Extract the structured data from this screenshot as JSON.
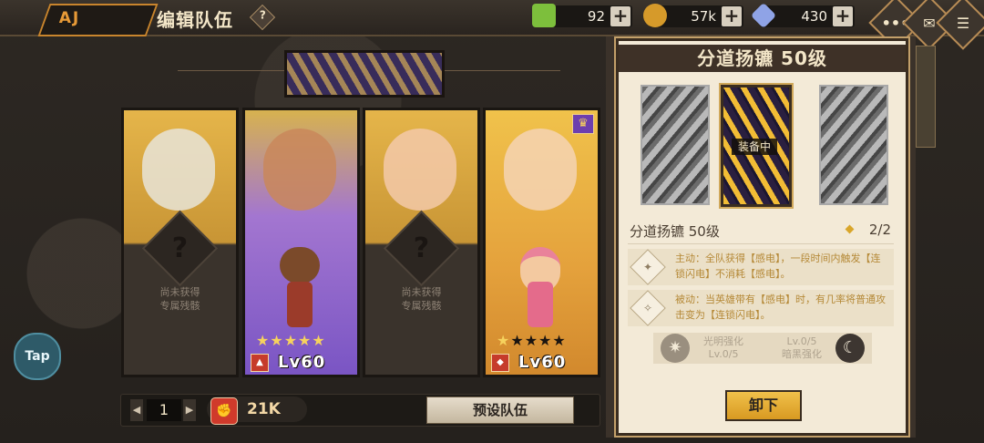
{
  "header": {
    "title": "编辑队伍",
    "help": "?",
    "logo_text": "AJ"
  },
  "resources": [
    {
      "name": "green-gem",
      "value": "92",
      "plus": "+",
      "color": "#7dbf3c"
    },
    {
      "name": "gold-coin",
      "value": "57k",
      "plus": "+",
      "color": "#d69a2a"
    },
    {
      "name": "crystal",
      "value": "430",
      "plus": "+",
      "color": "#8fa3e6"
    }
  ],
  "corner_buttons": [
    {
      "name": "chat-icon",
      "glyph": "•••"
    },
    {
      "name": "mail-icon",
      "glyph": "✉"
    },
    {
      "name": "menu-icon",
      "glyph": "☰"
    }
  ],
  "cards": [
    {
      "type": "empty",
      "unobtained_line1": "尚未获得",
      "unobtained_line2": "专属残骸",
      "lock": "?"
    },
    {
      "type": "hero",
      "color": "purple",
      "stars_on": 5,
      "stars_off": 0,
      "level": "Lv60",
      "class_glyph": "▲"
    },
    {
      "type": "empty",
      "unobtained_line1": "尚未获得",
      "unobtained_line2": "专属残骸",
      "lock": "?"
    },
    {
      "type": "hero",
      "color": "gold",
      "stars_on": 1,
      "stars_off": 4,
      "level": "Lv60",
      "class_glyph": "◆",
      "crown": "♛"
    }
  ],
  "bottom": {
    "prev": "◀",
    "next": "▶",
    "team_number": "1",
    "power_icon": "✊",
    "power": "21K",
    "preset_label": "预设队伍"
  },
  "panel": {
    "title": "分道扬镳  50级",
    "equipped_tag": "装备中",
    "weapon_name": "分道扬镳 50级",
    "weapon_count": "2/2",
    "skill1_icon": "✦",
    "skill1": "主动：全队获得【感电】，一段时间内触发【连锁闪电】不消耗【感电】。",
    "skill2_icon": "✧",
    "skill2": "被动：当英雄带有【感电】时，有几率将普通攻击变为【连锁闪电】。",
    "light_label": "光明强化",
    "light_level": "Lv.0/5",
    "dark_label": "暗黑强化",
    "dark_level": "Lv.0/5",
    "light_icon": "✷",
    "dark_icon": "☾",
    "unequip_label": "卸下"
  },
  "overlay": {
    "tap_label": "Tap"
  }
}
